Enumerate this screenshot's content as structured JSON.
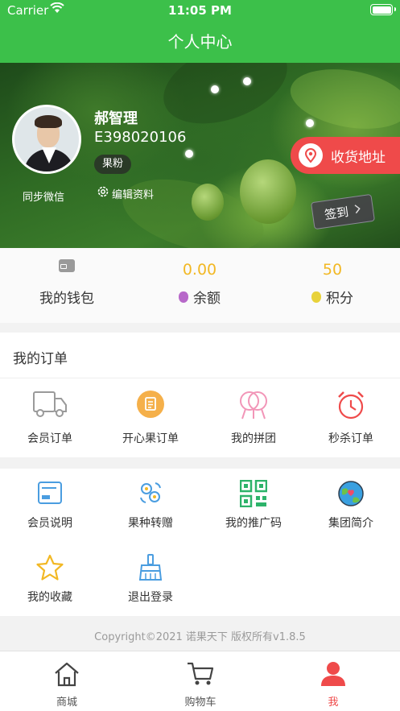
{
  "status_bar": {
    "carrier": "Carrier",
    "time": "11:05 PM"
  },
  "nav": {
    "title": "个人中心"
  },
  "profile": {
    "name": "郝智理",
    "user_id": "E398020106",
    "badge": "果粉",
    "sync_label": "同步微信",
    "edit_label": "编辑资料",
    "address_label": "收货地址",
    "signin_label": "签到"
  },
  "wallet": {
    "wallet_label": "我的钱包",
    "balance_value": "0.00",
    "balance_label": "余额",
    "points_value": "50",
    "points_label": "积分"
  },
  "orders": {
    "title": "我的订单",
    "items": [
      {
        "label": "会员订单",
        "icon": "truck-icon"
      },
      {
        "label": "开心果订单",
        "icon": "clipboard-icon"
      },
      {
        "label": "我的拼团",
        "icon": "group-icon"
      },
      {
        "label": "秒杀订单",
        "icon": "alarm-clock-icon"
      }
    ]
  },
  "tools": {
    "items": [
      {
        "label": "会员说明",
        "icon": "card-icon"
      },
      {
        "label": "果种转赠",
        "icon": "transfer-icon"
      },
      {
        "label": "我的推广码",
        "icon": "qr-code-icon"
      },
      {
        "label": "集团简介",
        "icon": "globe-heart-icon"
      },
      {
        "label": "我的收藏",
        "icon": "star-icon"
      },
      {
        "label": "退出登录",
        "icon": "broom-icon"
      }
    ]
  },
  "footer": {
    "copyright": "Copyright©2021 诺果天下 版权所有v1.8.5"
  },
  "tabbar": {
    "items": [
      {
        "label": "商城",
        "icon": "home-icon"
      },
      {
        "label": "购物车",
        "icon": "cart-icon"
      },
      {
        "label": "我",
        "icon": "person-icon"
      }
    ],
    "active_color": "#ef4a4a"
  },
  "colors": {
    "brand_green": "#3cc04a",
    "accent_yellow": "#f2b824",
    "accent_red": "#ef4a4a"
  }
}
